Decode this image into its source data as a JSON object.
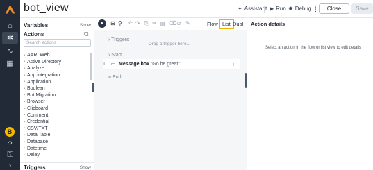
{
  "app": {
    "title": "bot_view",
    "accent": "#f0b000"
  },
  "rail": {
    "icons": [
      "logo-icon",
      "home-icon",
      "bot-icon",
      "pulse-icon",
      "grid-icon"
    ],
    "bottom_icons": [
      "user-badge-icon",
      "help-icon",
      "key-icon",
      "chevron-right-icon"
    ],
    "badge_label": "B"
  },
  "header": {
    "assistant_label": "Assistant",
    "run_label": "Run",
    "debug_label": "Debug",
    "close_label": "Close",
    "save_label": "Save"
  },
  "panel": {
    "variables_title": "Variables",
    "variables_show": "Show",
    "actions_title": "Actions",
    "search_placeholder": "Search actions",
    "actions": [
      "AARI Web",
      "Active Directory",
      "Analyze",
      "App integration",
      "Application",
      "Boolean",
      "Bot Migration",
      "Browser",
      "Clipboard",
      "Comment",
      "Credential",
      "CSV/TXT",
      "Data Table",
      "Database",
      "Datetime",
      "Delay"
    ],
    "triggers_title": "Triggers",
    "triggers_show": "Show"
  },
  "toolbar": {
    "view_tabs": [
      "Flow",
      "List",
      "Dual"
    ],
    "selected_tab": "List"
  },
  "canvas": {
    "triggers_label": "Triggers",
    "drag_hint": "Drag a trigger here...",
    "start_label": "Start",
    "step_number": "1",
    "step_action": "Message box",
    "step_text": "'Go be great!'",
    "end_label": "End"
  },
  "details": {
    "title": "Action details",
    "empty_message": "Select an action in the flow or list view to edit details"
  }
}
